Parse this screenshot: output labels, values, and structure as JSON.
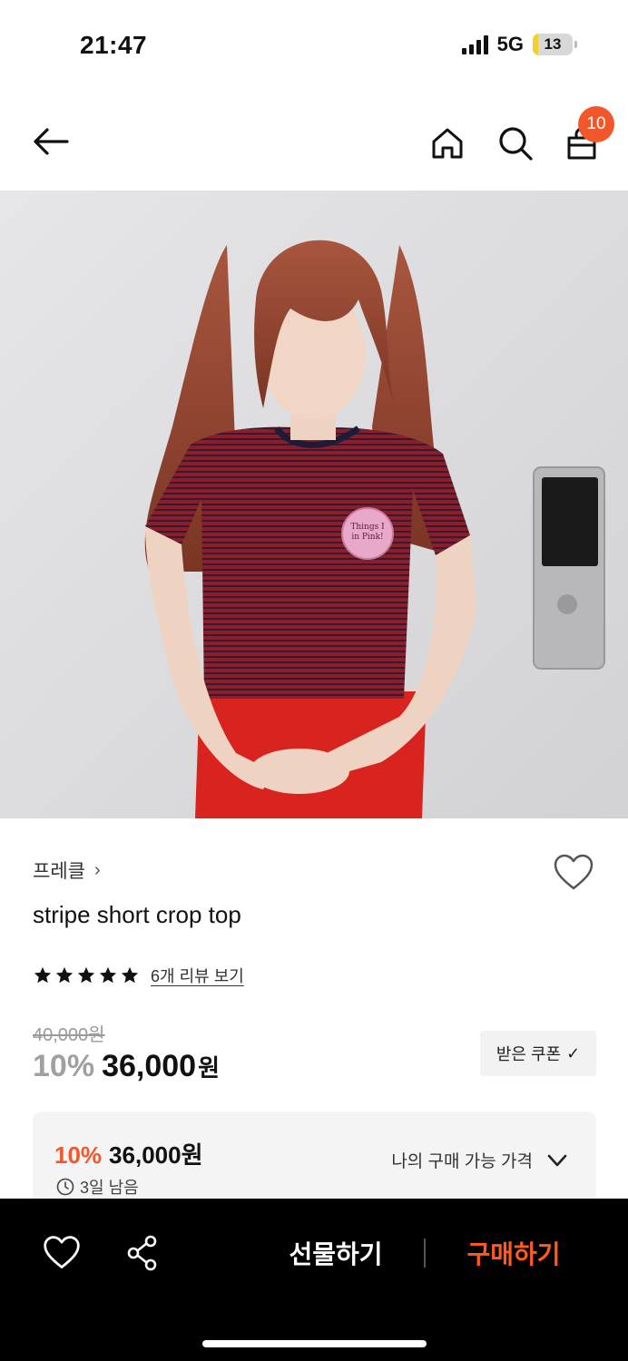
{
  "status_bar": {
    "time": "21:47",
    "network": "5G",
    "battery": "13",
    "battery_level_percent": 13
  },
  "top_nav": {
    "back_icon": "arrow-left-icon",
    "home_icon": "home-icon",
    "search_icon": "search-icon",
    "cart_icon": "shopping-bag-icon",
    "cart_count": "10"
  },
  "product": {
    "image_description_icon": "product-photo",
    "brand": "프레클",
    "brand_chevron": "›",
    "title": "stripe short crop top",
    "rating_stars": 5,
    "review_link": "6개 리뷰 보기",
    "original_price": "40,000원",
    "discount": "10%",
    "price": "36,000",
    "price_unit": "원",
    "coupon_label": "받은 쿠폰",
    "coupon_check": "✓"
  },
  "my_price": {
    "discount": "10%",
    "price": "36,000원",
    "remaining": "3일 남음",
    "toggle_label": "나의 구매 가능 가격"
  },
  "bottom_bar": {
    "gift_label": "선물하기",
    "buy_label": "구매하기"
  },
  "colors": {
    "accent": "#f2572b",
    "buy": "#ff5a1f",
    "bar": "#000000"
  }
}
